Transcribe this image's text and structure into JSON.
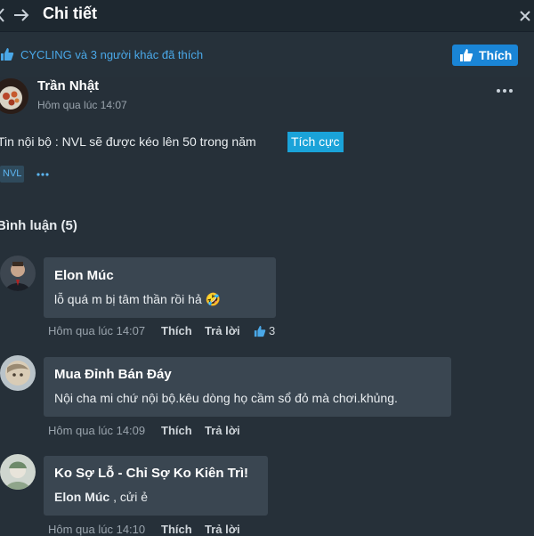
{
  "header": {
    "title": "Chi tiết",
    "back_icon": "arrow-left-icon",
    "forward_icon": "arrow-right-icon",
    "close_icon": "close-icon"
  },
  "likes": {
    "text": "CYCLING và 3 người khác đã thích",
    "button_label": "Thích",
    "accent": "#1a85d6"
  },
  "post": {
    "author": "Trần Nhật",
    "time": "Hôm qua lúc 14:07",
    "text": "Tin nội bộ : NVL sẽ được kéo lên 50 trong năm",
    "sentiment": "Tích cực",
    "tag": "NVL"
  },
  "comments_heading": "Bình luận (5)",
  "comments": [
    {
      "author": "Elon Múc",
      "text": "lỗ quá m bị tâm thần rồi hả 🤣",
      "time": "Hôm qua lúc 14:07",
      "like_label": "Thích",
      "reply_label": "Trả lời",
      "like_count": "3"
    },
    {
      "author": "Mua Đỉnh Bán Đáy",
      "text": "Nội cha mi chứ nội bộ.kêu dòng họ cầm sổ đỏ mà chơi.khủng.",
      "time": "Hôm qua lúc 14:09",
      "like_label": "Thích",
      "reply_label": "Trả lời"
    },
    {
      "author": "Ko Sợ Lỗ - Chỉ Sợ Ko Kiên Trì!",
      "mention": "Elon Múc",
      "text": " , cửi ẻ",
      "time": "Hôm qua lúc 14:10",
      "like_label": "Thích",
      "reply_label": "Trả lời"
    }
  ]
}
